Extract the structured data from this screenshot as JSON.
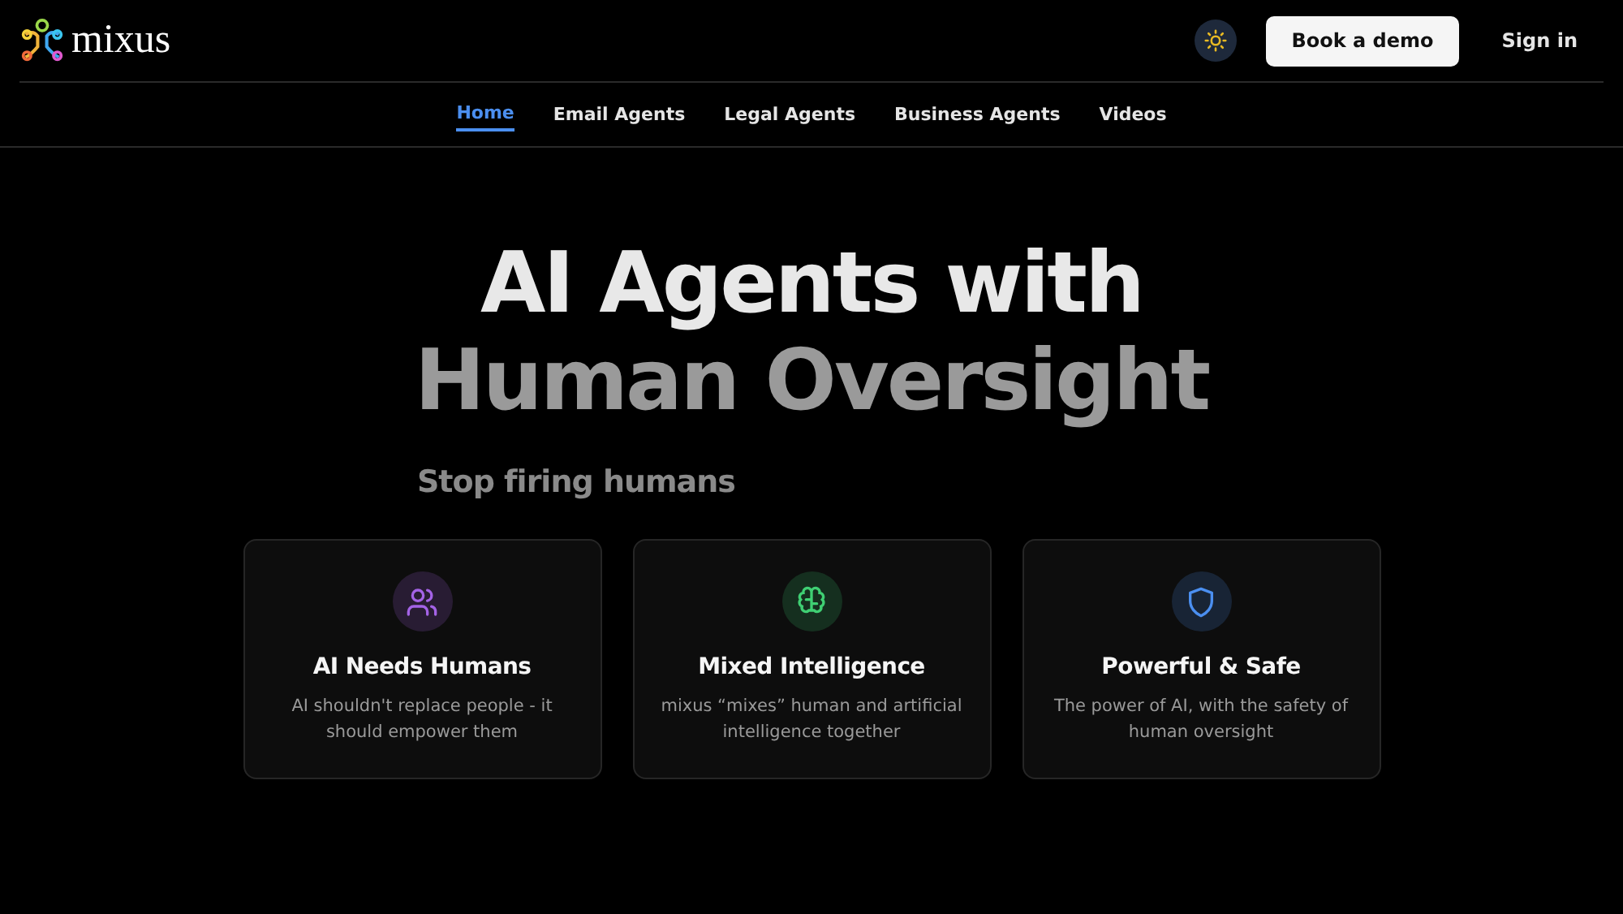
{
  "header": {
    "logo_text": "mixus",
    "buttons": [
      {
        "kind": "primary",
        "label": "Book a demo"
      },
      {
        "kind": "plain",
        "label": "Sign in"
      }
    ]
  },
  "nav": [
    {
      "label": "Home",
      "selected": true
    },
    {
      "label": "Email Agents",
      "selected": false
    },
    {
      "label": "Legal Agents",
      "selected": false
    },
    {
      "label": "Business Agents",
      "selected": false
    },
    {
      "label": "Videos",
      "selected": false
    }
  ],
  "hero": {
    "title_line_1": "AI Agents with",
    "title_line_2": "Human Oversight",
    "subtitle": "Stop firing humans"
  },
  "cards": [
    {
      "kind": "people",
      "color": "#a463e6",
      "title": "AI Needs Humans",
      "text": "AI shouldn't replace people - it should empower them"
    },
    {
      "kind": "brain",
      "color": "#3fcf73",
      "title": "Mixed Intelligence",
      "text": "mixus “mixes” human and artificial intelligence together"
    },
    {
      "kind": "shield",
      "color": "#4b8ff0",
      "title": "Powerful & Safe",
      "text": "The power of AI, with the safety of human oversight"
    }
  ]
}
